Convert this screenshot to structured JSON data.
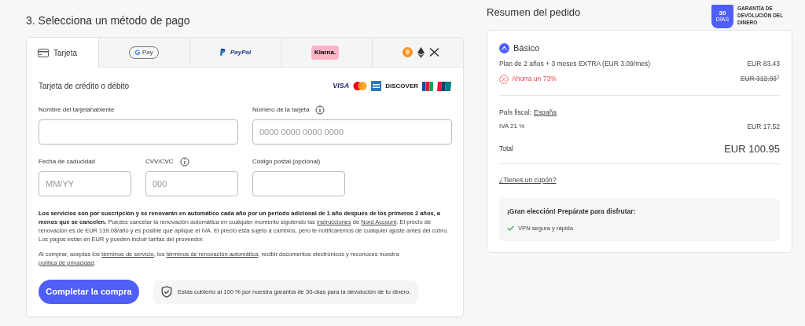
{
  "payment": {
    "heading": "3. Selecciona un método de pago",
    "tabs": [
      {
        "kind": "card",
        "label": "Tarjeta",
        "selected": true
      },
      {
        "kind": "gpay",
        "label": "Pay",
        "selected": false
      },
      {
        "kind": "paypal",
        "label": "PayPal",
        "selected": false
      },
      {
        "kind": "klarna",
        "label": "Klarna.",
        "selected": false
      },
      {
        "kind": "crypto",
        "selected": false
      }
    ],
    "card_title": "Tarjeta de crédito o débito",
    "card_brands": [
      {
        "kind": "visa",
        "text": "VISA"
      },
      {
        "kind": "mastercard"
      },
      {
        "kind": "amex"
      },
      {
        "kind": "discover",
        "text": "DISCOVER"
      },
      {
        "kind": "jcb"
      },
      {
        "kind": "unionpay"
      }
    ],
    "fields": [
      {
        "label": "Nombre del tarjetahabiente",
        "info": false,
        "kind": "wide"
      },
      {
        "label": "Número de la tarjeta",
        "info": true,
        "kind": "wide",
        "placeholder": "0000 0000 0000 0000"
      },
      {
        "label": "Fecha de caducidad",
        "info": false,
        "kind": "narrow",
        "placeholder": "MM/YY"
      },
      {
        "label": "CVV/CVC",
        "info": true,
        "kind": "narrow",
        "placeholder": "000"
      },
      {
        "label": "Código postal (opcional)",
        "info": false,
        "kind": "narrow"
      }
    ],
    "legal": [
      [
        {
          "kind": "bold",
          "text": "Los servicios son por suscripción y se renovarán en automático cada año por un periodo adicional de 1 año después de los primeros 2 años, a menos que se cancelen."
        },
        {
          "kind": "plain",
          "text": " Puedes cancelar la renovación automática en cualquier momento siguiendo las "
        },
        {
          "kind": "link",
          "text": "instrucciones"
        },
        {
          "kind": "plain",
          "text": " de "
        },
        {
          "kind": "link",
          "text": "Nord Account"
        },
        {
          "kind": "plain",
          "text": ". El precio de renovación es de EUR 139.08/año y es posible que aplique el IVA. El precio está sujeto a cambios, pero te notificaremos de cualquier ajuste antes del cobro. Los pagos están en EUR y pueden incluir tarifas del proveedor."
        }
      ],
      [
        {
          "kind": "plain",
          "text": "Al comprar, aceptas los "
        },
        {
          "kind": "link",
          "text": "términos de servicio"
        },
        {
          "kind": "plain",
          "text": ", los "
        },
        {
          "kind": "link",
          "text": "términos de renovación automática"
        },
        {
          "kind": "plain",
          "text": ", recibir documentos electrónicos y reconoces nuestra "
        },
        {
          "kind": "link",
          "text": "política de privacidad"
        },
        {
          "kind": "plain",
          "text": "."
        }
      ]
    ],
    "submit": "Completar la compra",
    "guarantee_note": "Estás cubierto al 100 % por nuestra garantía de 30-días para la devolución de tu dinero."
  },
  "summary": {
    "title": "Resumen del pedido",
    "badge": {
      "days": "30",
      "unit": "DÍAS",
      "text": "GARANTÍA DE DEVOLUCIÓN DEL DINERO"
    },
    "plan": "Básico",
    "plan_line": "Plan de 2 años + 3 meses EXTRA (EUR 3.09/mes)",
    "plan_price": "EUR 83.43",
    "saving": "Ahorra un 73%",
    "old_price": "EUR 312.93",
    "footnote": "1",
    "country_label": "País fiscal:",
    "country": "España",
    "tax_label": "IVA 21 %",
    "tax": "EUR 17.52",
    "total_label": "Total",
    "total": "EUR 100.95",
    "coupon": "¿Tienes un cupón?",
    "perks_title": "¡Gran elección! Prepárate para disfrutar:",
    "perks": [
      "VPN segura y rápida"
    ]
  }
}
